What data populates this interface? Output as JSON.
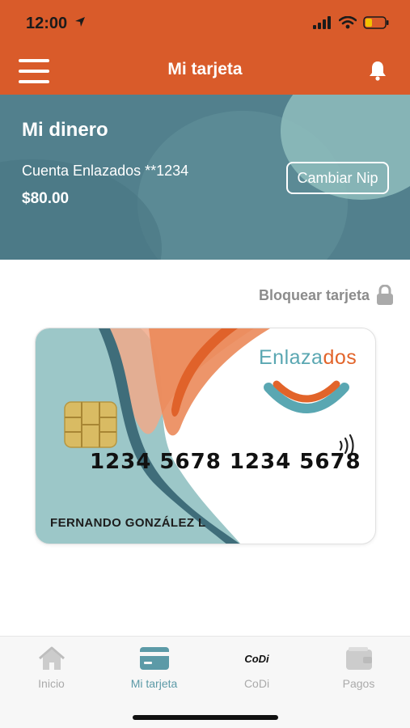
{
  "status_bar": {
    "time": "12:00"
  },
  "header": {
    "title": "Mi tarjeta"
  },
  "balance": {
    "title": "Mi dinero",
    "account": "Cuenta Enlazados **1234",
    "amount": "$80.00",
    "change_pin_label": "Cambiar Nip"
  },
  "block_card": {
    "label": "Bloquear tarjeta"
  },
  "card": {
    "brand_prefix": "Enlaza",
    "brand_suffix": "dos",
    "number": "1234 5678 1234 5678",
    "holder": "FERNANDO GONZÁLEZ L"
  },
  "bottom_nav": {
    "items": [
      {
        "label": "Inicio",
        "icon": "home-icon"
      },
      {
        "label": "Mi tarjeta",
        "icon": "card-icon"
      },
      {
        "label": "CoDi",
        "icon": "codi-icon",
        "icon_text": "CoDi"
      },
      {
        "label": "Pagos",
        "icon": "wallet-icon"
      }
    ],
    "active_index": 1
  },
  "colors": {
    "brand_orange": "#d95b2a",
    "teal": "#52808d",
    "accent_teal": "#5c9aa7"
  }
}
